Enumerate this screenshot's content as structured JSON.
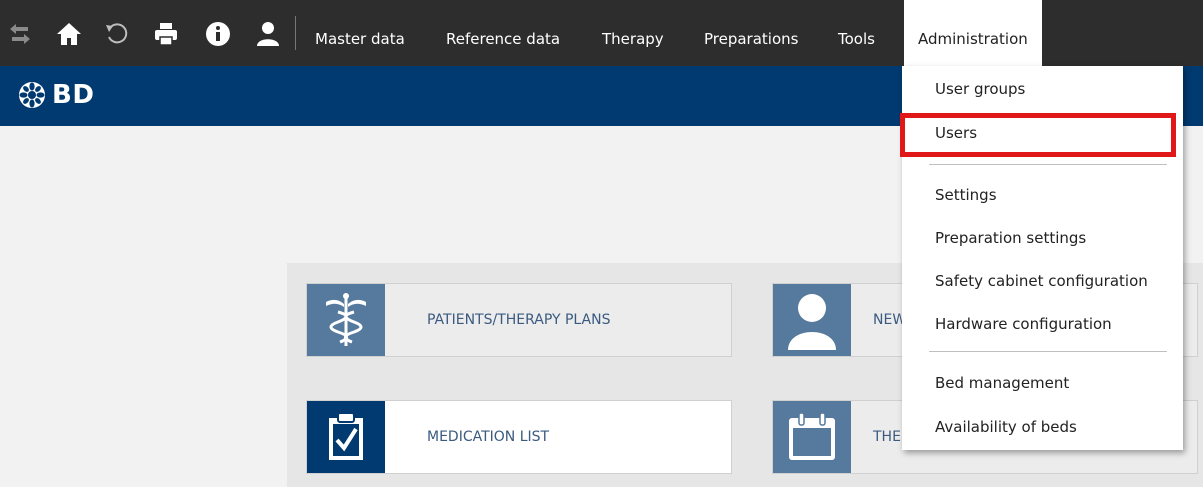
{
  "toolbar": {
    "icons": [
      "swap-arrows-icon",
      "home-icon",
      "refresh-icon",
      "print-icon",
      "info-icon",
      "user-icon"
    ]
  },
  "menu": {
    "master_data": "Master data",
    "reference_data": "Reference data",
    "therapy": "Therapy",
    "preparations": "Preparations",
    "tools": "Tools",
    "administration": "Administration"
  },
  "brand": {
    "name": "BD"
  },
  "tiles": {
    "patients": "PATIENTS/THERAPY PLANS",
    "new_patient": "NEW",
    "medication_list": "MEDICATION LIST",
    "therapy": "THE"
  },
  "administration_menu": {
    "user_groups": "User groups",
    "users": "Users",
    "settings": "Settings",
    "preparation_settings": "Preparation settings",
    "safety_cabinet": "Safety cabinet configuration",
    "hardware": "Hardware configuration",
    "bed_management": "Bed management",
    "availability_of_beds": "Availability of beds"
  },
  "colors": {
    "topbar": "#2d2d2d",
    "brandbar": "#003a70",
    "tile_icon": "#567a9d",
    "highlight": "#e01818"
  }
}
